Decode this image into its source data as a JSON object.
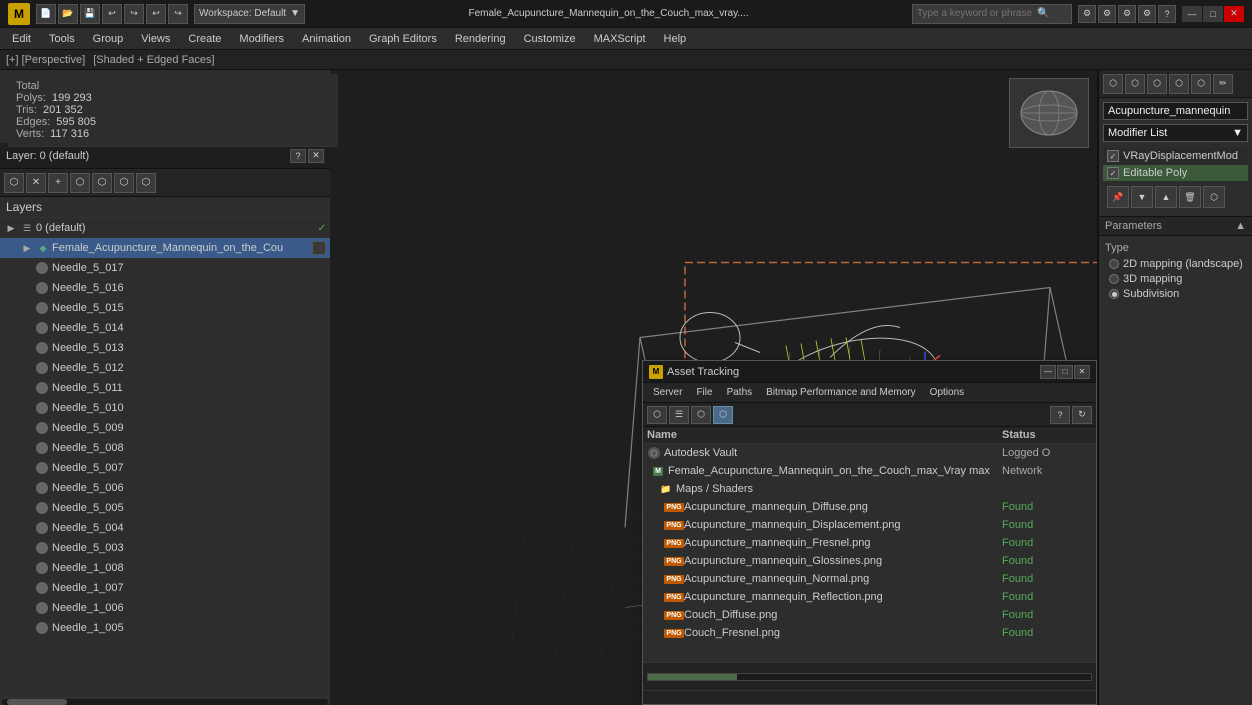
{
  "titlebar": {
    "logo_text": "M",
    "file_title": "Female_Acupuncture_Mannequin_on_the_Couch_max_vray....",
    "workspace_label": "Workspace: Default",
    "search_placeholder": "Type a keyword or phrase",
    "minimize_label": "—",
    "maximize_label": "□",
    "close_label": "✕"
  },
  "menubar": {
    "items": [
      "Edit",
      "Tools",
      "Group",
      "Views",
      "Create",
      "Modifiers",
      "Animation",
      "Graph Editors",
      "Rendering",
      "Customize",
      "MAXScript",
      "Help"
    ]
  },
  "viewport": {
    "label": "[+] [Perspective]",
    "shading": "[Shaded + Edged Faces]"
  },
  "stats": {
    "polys_label": "Polys:",
    "polys_value": "199 293",
    "tris_label": "Tris:",
    "tris_value": "201 352",
    "edges_label": "Edges:",
    "edges_value": "595 805",
    "verts_label": "Verts:",
    "verts_value": "117 316",
    "total_label": "Total"
  },
  "layers_window": {
    "title": "Layer: 0 (default)",
    "help_label": "?",
    "close_label": "✕",
    "toolbar_icons": [
      "⬡",
      "✕",
      "+",
      "⬡",
      "⬡",
      "⬡",
      "⬡"
    ],
    "header_label": "Layers",
    "items": [
      {
        "id": "layer0",
        "name": "0 (default)",
        "indent": 0,
        "type": "layer",
        "checked": true
      },
      {
        "id": "female",
        "name": "Female_Acupuncture_Mannequin_on_the_Cou",
        "indent": 1,
        "type": "object",
        "selected": true
      },
      {
        "id": "needle_017",
        "name": "Needle_5_017",
        "indent": 2,
        "type": "needle"
      },
      {
        "id": "needle_016",
        "name": "Needle_5_016",
        "indent": 2,
        "type": "needle"
      },
      {
        "id": "needle_015",
        "name": "Needle_5_015",
        "indent": 2,
        "type": "needle"
      },
      {
        "id": "needle_014",
        "name": "Needle_5_014",
        "indent": 2,
        "type": "needle"
      },
      {
        "id": "needle_013",
        "name": "Needle_5_013",
        "indent": 2,
        "type": "needle"
      },
      {
        "id": "needle_012",
        "name": "Needle_5_012",
        "indent": 2,
        "type": "needle"
      },
      {
        "id": "needle_011",
        "name": "Needle_5_011",
        "indent": 2,
        "type": "needle"
      },
      {
        "id": "needle_010",
        "name": "Needle_5_010",
        "indent": 2,
        "type": "needle"
      },
      {
        "id": "needle_009",
        "name": "Needle_5_009",
        "indent": 2,
        "type": "needle"
      },
      {
        "id": "needle_008",
        "name": "Needle_5_008",
        "indent": 2,
        "type": "needle"
      },
      {
        "id": "needle_007",
        "name": "Needle_5_007",
        "indent": 2,
        "type": "needle"
      },
      {
        "id": "needle_006",
        "name": "Needle_5_006",
        "indent": 2,
        "type": "needle"
      },
      {
        "id": "needle_005",
        "name": "Needle_5_005",
        "indent": 2,
        "type": "needle"
      },
      {
        "id": "needle_004",
        "name": "Needle_5_004",
        "indent": 2,
        "type": "needle"
      },
      {
        "id": "needle_003",
        "name": "Needle_5_003",
        "indent": 2,
        "type": "needle"
      },
      {
        "id": "needle1_008",
        "name": "Needle_1_008",
        "indent": 2,
        "type": "needle"
      },
      {
        "id": "needle1_007",
        "name": "Needle_1_007",
        "indent": 2,
        "type": "needle"
      },
      {
        "id": "needle1_006",
        "name": "Needle_1_006",
        "indent": 2,
        "type": "needle"
      },
      {
        "id": "needle1_005",
        "name": "Needle_1_005",
        "indent": 2,
        "type": "needle"
      }
    ]
  },
  "right_panel": {
    "modifier_name": "Acupuncture_mannequin",
    "modifier_list_label": "Modifier List",
    "modifiers": [
      {
        "name": "VRayDisplacementMod",
        "enabled": true
      },
      {
        "name": "Editable Poly",
        "enabled": true,
        "selected": true
      }
    ],
    "tool_icons": [
      "◄",
      "▼",
      "◄▼",
      "▲",
      "⬡"
    ],
    "params_header": "Parameters",
    "type_label": "Type",
    "type_options": [
      {
        "label": "2D mapping (landscape)",
        "active": true
      },
      {
        "label": "3D mapping",
        "active": false
      },
      {
        "label": "Subdivision",
        "active": true
      }
    ]
  },
  "asset_tracking": {
    "title": "Asset Tracking",
    "minimize_label": "—",
    "maximize_label": "□",
    "close_label": "✕",
    "menu_items": [
      "Server",
      "File",
      "Paths",
      "Bitmap Performance and Memory",
      "Options"
    ],
    "col_name": "Name",
    "col_status": "Status",
    "rows": [
      {
        "name": "Autodesk Vault",
        "status": "Logged O",
        "status_class": "logged",
        "indent": 0,
        "icon": "vault"
      },
      {
        "name": "Female_Acupuncture_Mannequin_on_the_Couch_max_Vray max",
        "status": "Network",
        "status_class": "network",
        "indent": 1,
        "icon": "max"
      },
      {
        "name": "Maps / Shaders",
        "status": "",
        "indent": 2,
        "icon": "folder"
      },
      {
        "name": "Acupuncture_mannequin_Diffuse.png",
        "status": "Found",
        "status_class": "found",
        "indent": 3,
        "icon": "png"
      },
      {
        "name": "Acupuncture_mannequin_Displacement.png",
        "status": "Found",
        "status_class": "found",
        "indent": 3,
        "icon": "png"
      },
      {
        "name": "Acupuncture_mannequin_Fresnel.png",
        "status": "Found",
        "status_class": "found",
        "indent": 3,
        "icon": "png"
      },
      {
        "name": "Acupuncture_mannequin_Glossines.png",
        "status": "Found",
        "status_class": "found",
        "indent": 3,
        "icon": "png"
      },
      {
        "name": "Acupuncture_mannequin_Normal.png",
        "status": "Found",
        "status_class": "found",
        "indent": 3,
        "icon": "png"
      },
      {
        "name": "Acupuncture_mannequin_Reflection.png",
        "status": "Found",
        "status_class": "found",
        "indent": 3,
        "icon": "png"
      },
      {
        "name": "Couch_Diffuse.png",
        "status": "Found",
        "status_class": "found",
        "indent": 3,
        "icon": "png"
      },
      {
        "name": "Couch_Fresnel.png",
        "status": "Found",
        "status_class": "found",
        "indent": 3,
        "icon": "png"
      }
    ]
  }
}
